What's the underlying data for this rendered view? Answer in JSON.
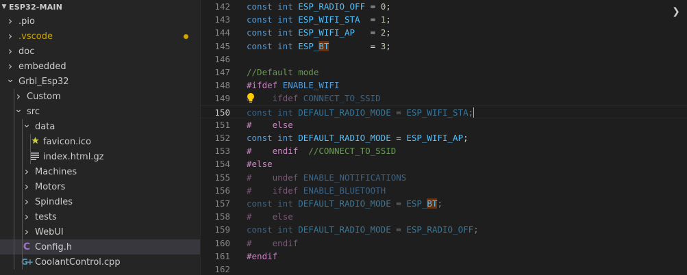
{
  "explorer": {
    "title": "ESP32-MAIN",
    "items": [
      {
        "label": ".pio",
        "depth": 0,
        "twisty": "closed",
        "icon": "",
        "color": "#cccccc"
      },
      {
        "label": ".vscode",
        "depth": 0,
        "twisty": "closed",
        "icon": "",
        "color": "#cca700",
        "modified": true
      },
      {
        "label": "doc",
        "depth": 0,
        "twisty": "closed",
        "icon": "",
        "color": "#cccccc"
      },
      {
        "label": "embedded",
        "depth": 0,
        "twisty": "closed",
        "icon": "",
        "color": "#cccccc"
      },
      {
        "label": "Grbl_Esp32",
        "depth": 0,
        "twisty": "open",
        "icon": "",
        "color": "#cccccc"
      },
      {
        "label": "Custom",
        "depth": 1,
        "twisty": "closed",
        "icon": "",
        "color": "#cccccc"
      },
      {
        "label": "src",
        "depth": 1,
        "twisty": "open",
        "icon": "",
        "color": "#cccccc"
      },
      {
        "label": "data",
        "depth": 2,
        "twisty": "open",
        "icon": "",
        "color": "#cccccc"
      },
      {
        "label": "favicon.ico",
        "depth": 3,
        "twisty": "",
        "icon": "star",
        "color": "#cccccc"
      },
      {
        "label": "index.html.gz",
        "depth": 3,
        "twisty": "",
        "icon": "lines",
        "color": "#cccccc"
      },
      {
        "label": "Machines",
        "depth": 2,
        "twisty": "closed",
        "icon": "",
        "color": "#cccccc"
      },
      {
        "label": "Motors",
        "depth": 2,
        "twisty": "closed",
        "icon": "",
        "color": "#cccccc"
      },
      {
        "label": "Spindles",
        "depth": 2,
        "twisty": "closed",
        "icon": "",
        "color": "#cccccc"
      },
      {
        "label": "tests",
        "depth": 2,
        "twisty": "closed",
        "icon": "",
        "color": "#cccccc"
      },
      {
        "label": "WebUI",
        "depth": 2,
        "twisty": "closed",
        "icon": "",
        "color": "#cccccc"
      },
      {
        "label": "Config.h",
        "depth": 2,
        "twisty": "",
        "icon": "c",
        "color": "#cccccc",
        "selected": true
      },
      {
        "label": "CoolantControl.cpp",
        "depth": 2,
        "twisty": "",
        "icon": "cpp",
        "color": "#cccccc"
      }
    ]
  },
  "editor": {
    "lines": [
      {
        "n": "142",
        "tokens": [
          [
            "kw",
            "const "
          ],
          [
            "kw",
            "int "
          ],
          [
            "cst",
            "ESP_RADIO_OFF"
          ],
          [
            "op",
            " = "
          ],
          [
            "num",
            "0"
          ],
          [
            "op",
            ";"
          ]
        ]
      },
      {
        "n": "143",
        "tokens": [
          [
            "kw",
            "const "
          ],
          [
            "kw",
            "int "
          ],
          [
            "cst",
            "ESP_WIFI_STA"
          ],
          [
            "op",
            "  = "
          ],
          [
            "num",
            "1"
          ],
          [
            "op",
            ";"
          ]
        ]
      },
      {
        "n": "144",
        "tokens": [
          [
            "kw",
            "const "
          ],
          [
            "kw",
            "int "
          ],
          [
            "cst",
            "ESP_WIFI_AP"
          ],
          [
            "op",
            "   = "
          ],
          [
            "num",
            "2"
          ],
          [
            "op",
            ";"
          ]
        ]
      },
      {
        "n": "145",
        "tokens": [
          [
            "kw",
            "const "
          ],
          [
            "kw",
            "int "
          ],
          [
            "cst",
            "ESP_"
          ],
          [
            "cst hl",
            "BT"
          ],
          [
            "op",
            "        = "
          ],
          [
            "num",
            "3"
          ],
          [
            "op",
            ";"
          ]
        ]
      },
      {
        "n": "146",
        "tokens": []
      },
      {
        "n": "147",
        "tokens": [
          [
            "cm",
            "//Default mode"
          ]
        ]
      },
      {
        "n": "148",
        "tokens": [
          [
            "pp",
            "#ifdef "
          ],
          [
            "mac",
            "ENABLE_WIFI"
          ]
        ]
      },
      {
        "n": "149",
        "bulb": true,
        "tokens": [
          [
            "pp dim",
            "#    "
          ],
          [
            "pp dim",
            "ifdef "
          ],
          [
            "mac dim",
            "CONNECT_TO_SSID"
          ]
        ]
      },
      {
        "n": "150",
        "current": true,
        "cursor": true,
        "tokens": [
          [
            "kw dim",
            "const "
          ],
          [
            "kw dim",
            "int "
          ],
          [
            "cst dim",
            "DEFAULT_RADIO_MODE"
          ],
          [
            "op dim",
            " = "
          ],
          [
            "cst dim",
            "ESP_WIFI_STA"
          ],
          [
            "op dim",
            ";"
          ]
        ]
      },
      {
        "n": "151",
        "tokens": [
          [
            "pp",
            "#    "
          ],
          [
            "pp",
            "else"
          ]
        ]
      },
      {
        "n": "152",
        "tokens": [
          [
            "kw",
            "const "
          ],
          [
            "kw",
            "int "
          ],
          [
            "cst",
            "DEFAULT_RADIO_MODE"
          ],
          [
            "op",
            " = "
          ],
          [
            "cst",
            "ESP_WIFI_AP"
          ],
          [
            "op",
            ";"
          ]
        ]
      },
      {
        "n": "153",
        "tokens": [
          [
            "pp",
            "#    "
          ],
          [
            "pp",
            "endif"
          ],
          [
            "cm",
            "  //CONNECT_TO_SSID"
          ]
        ]
      },
      {
        "n": "154",
        "tokens": [
          [
            "pp",
            "#else"
          ]
        ]
      },
      {
        "n": "155",
        "tokens": [
          [
            "pp dim",
            "#    "
          ],
          [
            "pp dim",
            "undef "
          ],
          [
            "mac dim",
            "ENABLE_NOTIFICATIONS"
          ]
        ]
      },
      {
        "n": "156",
        "tokens": [
          [
            "pp dim",
            "#    "
          ],
          [
            "pp dim",
            "ifdef "
          ],
          [
            "mac dim",
            "ENABLE_BLUETOOTH"
          ]
        ]
      },
      {
        "n": "157",
        "tokens": [
          [
            "kw dim",
            "const "
          ],
          [
            "kw dim",
            "int "
          ],
          [
            "cst dim",
            "DEFAULT_RADIO_MODE"
          ],
          [
            "op dim",
            " = "
          ],
          [
            "cst dim",
            "ESP_"
          ],
          [
            "cst hl",
            "BT"
          ],
          [
            "op dim",
            ";"
          ]
        ]
      },
      {
        "n": "158",
        "tokens": [
          [
            "pp dim",
            "#    "
          ],
          [
            "pp dim",
            "else"
          ]
        ]
      },
      {
        "n": "159",
        "tokens": [
          [
            "kw dim",
            "const "
          ],
          [
            "kw dim",
            "int "
          ],
          [
            "cst dim",
            "DEFAULT_RADIO_MODE"
          ],
          [
            "op dim",
            " = "
          ],
          [
            "cst dim",
            "ESP_RADIO_OFF"
          ],
          [
            "op dim",
            ";"
          ]
        ]
      },
      {
        "n": "160",
        "tokens": [
          [
            "pp dim",
            "#    "
          ],
          [
            "pp dim",
            "endif"
          ]
        ]
      },
      {
        "n": "161",
        "tokens": [
          [
            "pp",
            "#endif"
          ]
        ]
      },
      {
        "n": "162",
        "tokens": []
      }
    ]
  },
  "icons": {
    "explorer_collapse": "chevron-down-icon",
    "folder_closed": "chevron-right-icon",
    "folder_open": "chevron-down-icon",
    "favicon": "star-icon",
    "archive": "lines-icon",
    "c_header": "c-file-icon",
    "cpp_file": "cpp-file-icon",
    "lightbulb": "lightbulb-icon",
    "scroll_right": "chevron-right-icon"
  },
  "colors": {
    "accent_c": "#a074c4",
    "accent_cpp": "#519aba",
    "star": "#cbcb41",
    "bulb": "#ffcc00",
    "modified": "#cca700"
  }
}
